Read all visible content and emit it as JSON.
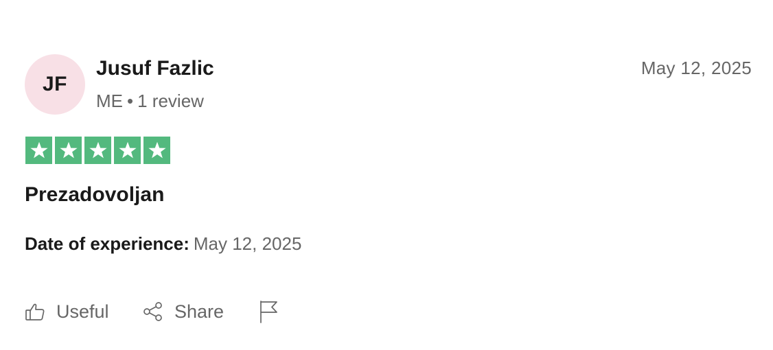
{
  "reviewer": {
    "initials": "JF",
    "name": "Jusuf Fazlic",
    "country": "ME",
    "separator": "•",
    "review_count": "1 review",
    "avatar_color": "#f8e0e6"
  },
  "review": {
    "date": "May 12, 2025",
    "rating": 5,
    "rating_max": 5,
    "star_color": "#53b97e",
    "title": "Prezadovoljan",
    "experience_label": "Date of experience:",
    "experience_date": "May 12, 2025"
  },
  "actions": {
    "useful_label": "Useful",
    "useful_icon": "thumbs-up-icon",
    "share_label": "Share",
    "share_icon": "share-icon",
    "report_icon": "flag-icon"
  }
}
